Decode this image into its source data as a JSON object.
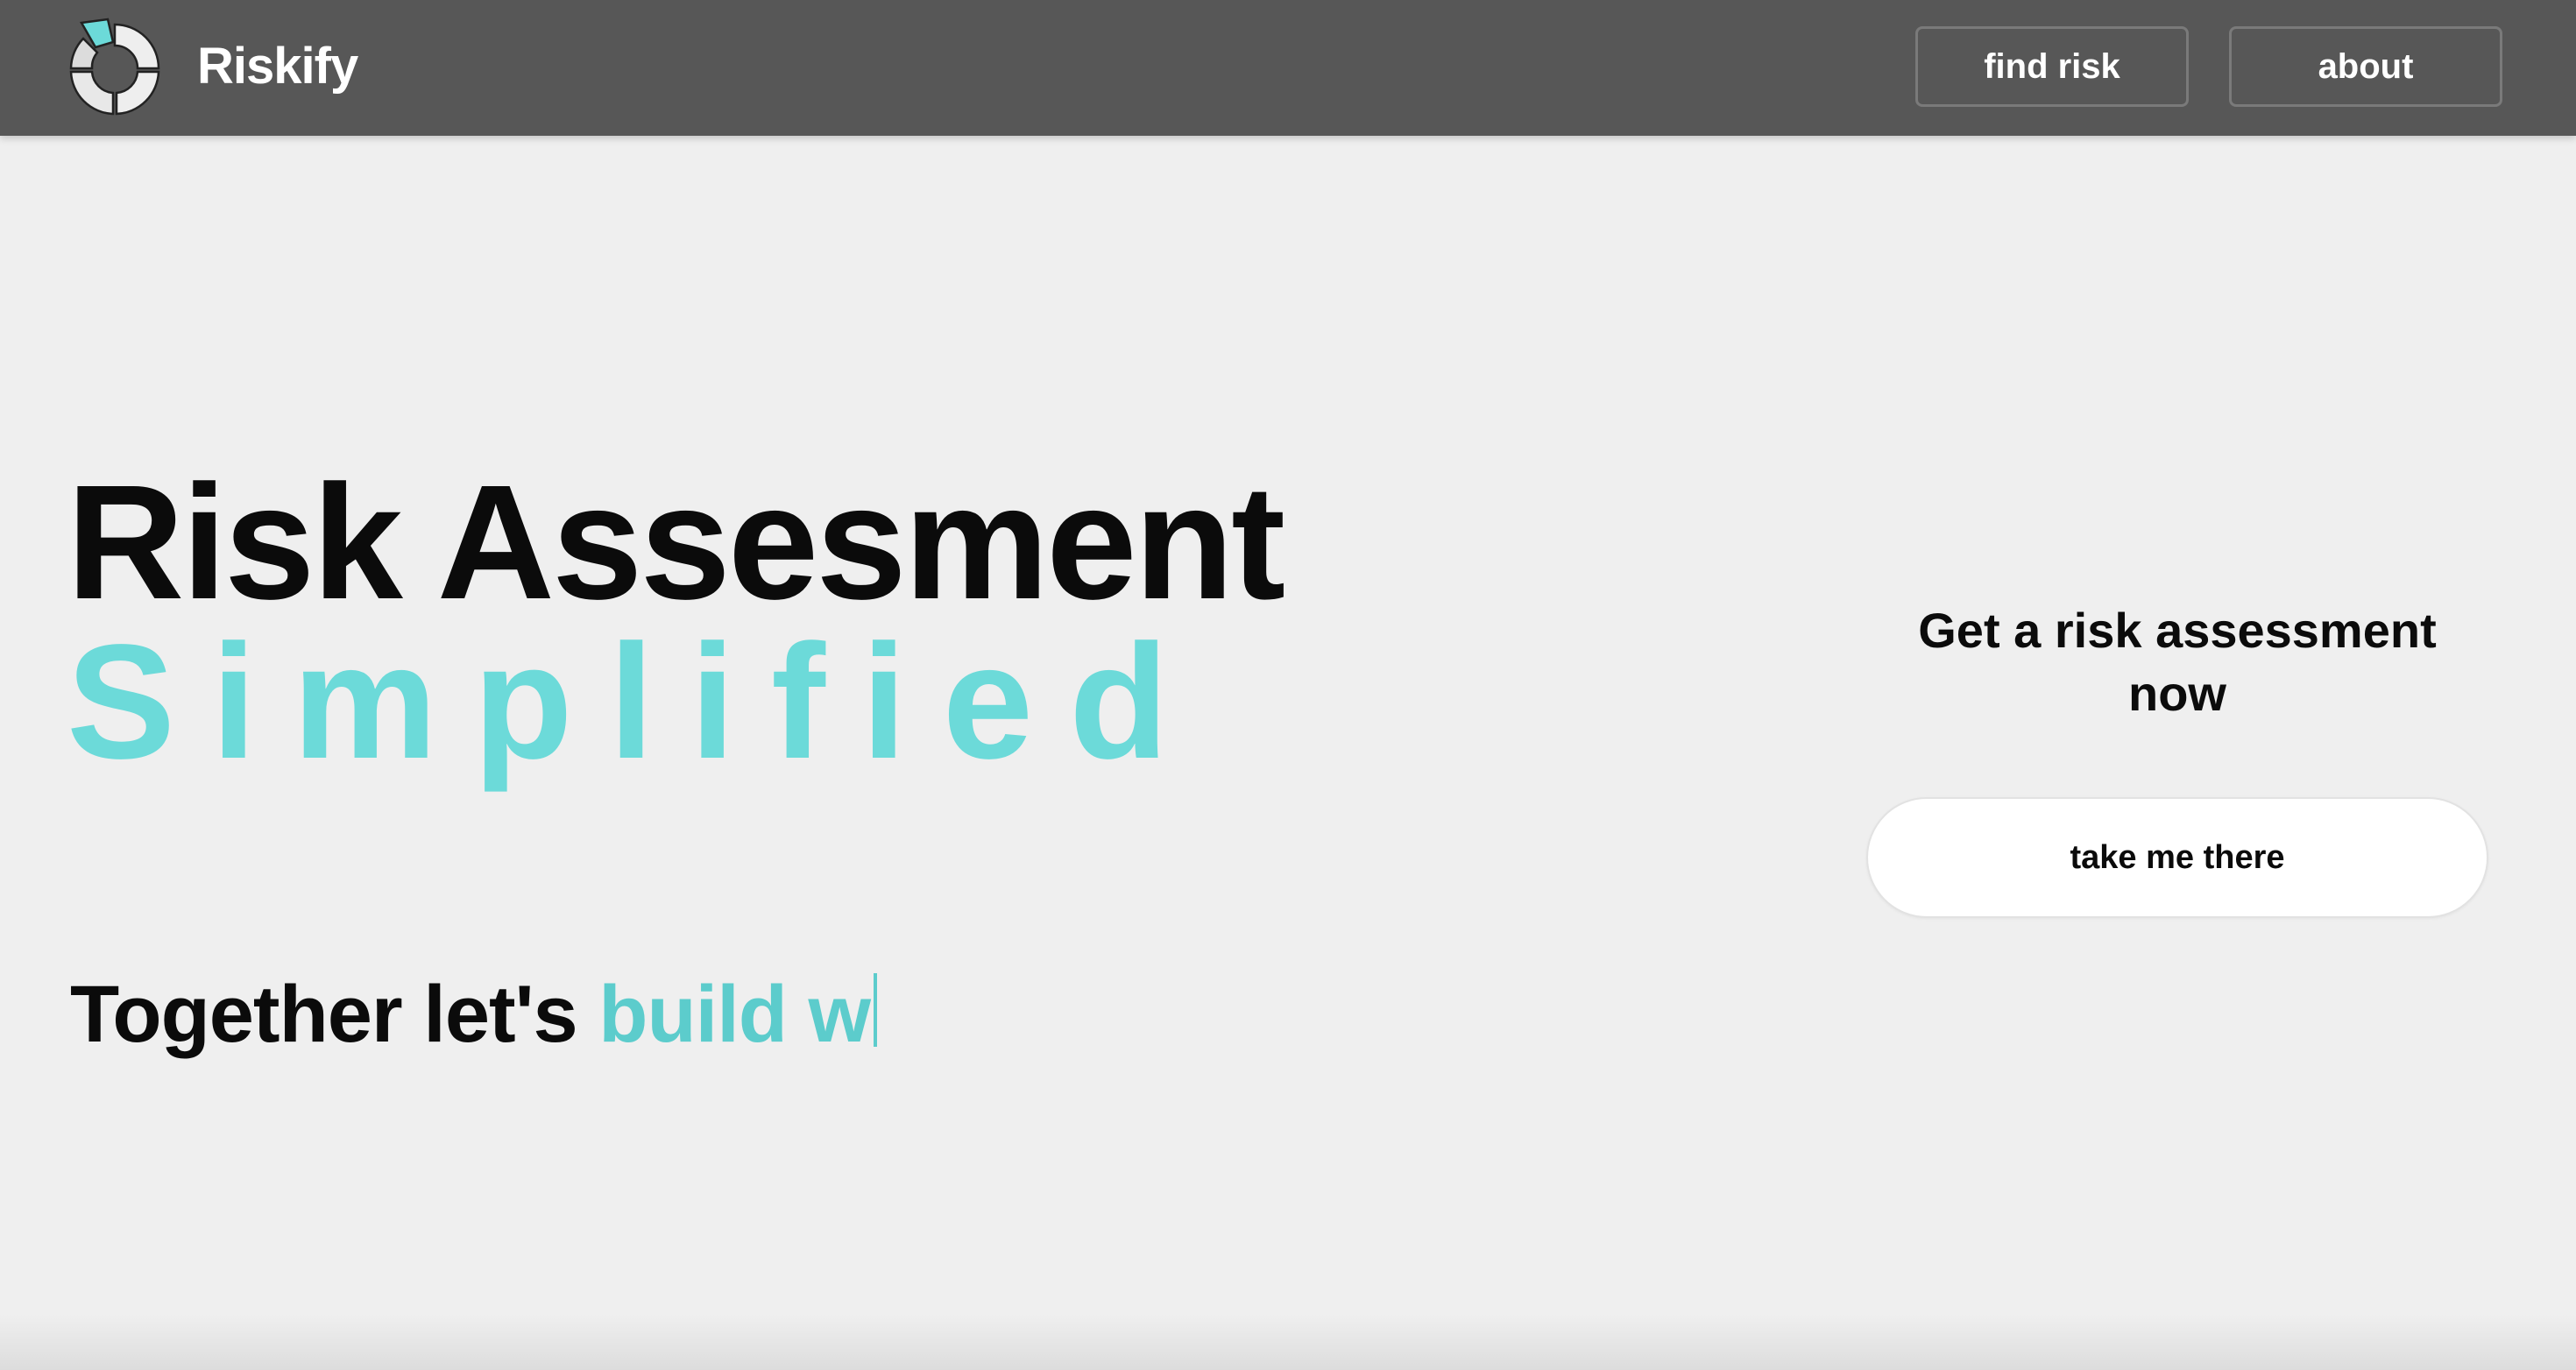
{
  "app": {
    "brand": "Riskify",
    "accent_color": "#6cdad9"
  },
  "nav": {
    "logo_icon": "pie-chart-icon",
    "items": [
      {
        "label": "find risk"
      },
      {
        "label": "about"
      }
    ]
  },
  "hero": {
    "title": "Risk Assesment",
    "subtitle": "Simplified",
    "tagline_prefix": "Together let's",
    "tagline_typed": "build w"
  },
  "cta": {
    "heading": "Get a risk assessment now",
    "button_label": "take me there"
  }
}
